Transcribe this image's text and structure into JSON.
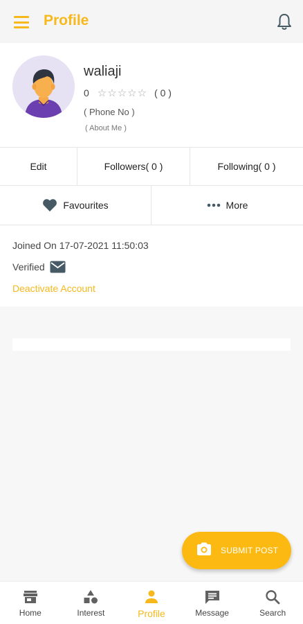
{
  "appbar": {
    "title": "Profile",
    "menu_icon": "hamburger-menu-icon",
    "bell_icon": "bell-icon"
  },
  "profile": {
    "name": "waliaji",
    "rating": "0",
    "stars": "☆☆☆☆☆",
    "rating_count": "( 0 )",
    "phone": "( Phone No )",
    "about": "( About Me )"
  },
  "actions": {
    "edit": "Edit",
    "followers": "Followers( 0 )",
    "following": "Following( 0 )",
    "favourites": "Favourites",
    "more": "More"
  },
  "info": {
    "joined": "Joined On 17-07-2021 11:50:03",
    "verified": "Verified",
    "deactivate": "Deactivate Account"
  },
  "fab": {
    "label": "SUBMIT POST"
  },
  "nav": {
    "items": [
      {
        "label": "Home",
        "icon": "store-icon"
      },
      {
        "label": "Interest",
        "icon": "shapes-icon"
      },
      {
        "label": "Profile",
        "icon": "person-icon"
      },
      {
        "label": "Message",
        "icon": "message-icon"
      },
      {
        "label": "Search",
        "icon": "search-icon"
      }
    ],
    "active": "Profile"
  },
  "colors": {
    "accent": "#f6b81b",
    "fab": "#fcb912",
    "icon": "#455a64"
  }
}
